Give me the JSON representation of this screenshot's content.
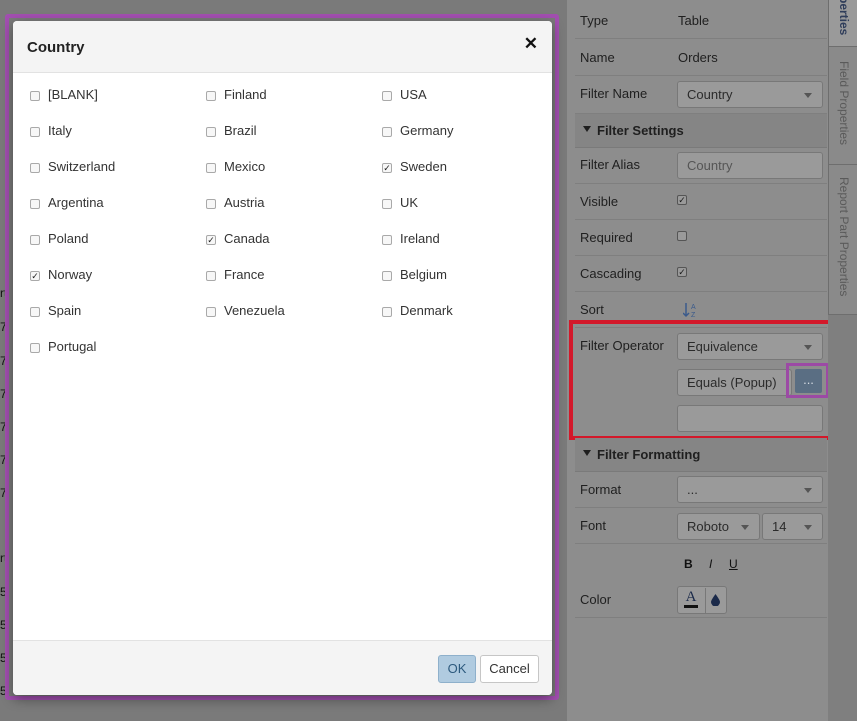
{
  "modal": {
    "title": "Country",
    "close_glyph": "✕",
    "columns": [
      [
        {
          "label": "[BLANK]",
          "checked": false
        },
        {
          "label": "Italy",
          "checked": false
        },
        {
          "label": "Switzerland",
          "checked": false
        },
        {
          "label": "Argentina",
          "checked": false
        },
        {
          "label": "Poland",
          "checked": false
        },
        {
          "label": "Norway",
          "checked": true
        },
        {
          "label": "Spain",
          "checked": false
        },
        {
          "label": "Portugal",
          "checked": false
        }
      ],
      [
        {
          "label": "Finland",
          "checked": false
        },
        {
          "label": "Brazil",
          "checked": false
        },
        {
          "label": "Mexico",
          "checked": false
        },
        {
          "label": "Austria",
          "checked": false
        },
        {
          "label": "Canada",
          "checked": true
        },
        {
          "label": "France",
          "checked": false
        },
        {
          "label": "Venezuela",
          "checked": false
        }
      ],
      [
        {
          "label": "USA",
          "checked": false
        },
        {
          "label": "Germany",
          "checked": false
        },
        {
          "label": "Sweden",
          "checked": true
        },
        {
          "label": "UK",
          "checked": false
        },
        {
          "label": "Ireland",
          "checked": false
        },
        {
          "label": "Belgium",
          "checked": false
        },
        {
          "label": "Denmark",
          "checked": false
        }
      ]
    ],
    "ok_label": "OK",
    "cancel_label": "Cancel"
  },
  "properties": {
    "type_label": "Type",
    "type_value": "Table",
    "name_label": "Name",
    "name_value": "Orders",
    "filter_name_label": "Filter Name",
    "filter_name_value": "Country",
    "filter_settings_header": "Filter Settings",
    "filter_alias_label": "Filter Alias",
    "filter_alias_placeholder": "Country",
    "visible_label": "Visible",
    "visible_checked": true,
    "required_label": "Required",
    "required_checked": false,
    "cascading_label": "Cascading",
    "cascading_checked": true,
    "sort_label": "Sort",
    "filter_operator_label": "Filter Operator",
    "operator_value": "Equivalence",
    "operator_detail_value": "Equals (Popup)",
    "ellipsis_label": "...",
    "filter_formatting_header": "Filter Formatting",
    "format_label": "Format",
    "format_value": "...",
    "font_label": "Font",
    "font_value": "Roboto",
    "font_size_value": "14",
    "bold_label": "B",
    "italic_label": "I",
    "underline_label": "U",
    "color_label": "Color",
    "color_a_glyph": "A",
    "color_drop_glyph": "💧"
  },
  "vertical_tabs": [
    "perties",
    "Field Properties",
    "Report Part Properties"
  ],
  "left_bg_glyphs": [
    "rt",
    "7",
    "7",
    "7",
    "7",
    "7",
    "7",
    "rt",
    "5",
    "5",
    "5",
    "5"
  ],
  "colors": {
    "highlight_red": "#d3182a",
    "highlight_purple": "#a24fb0",
    "ok_button": "#b0cbe0"
  }
}
